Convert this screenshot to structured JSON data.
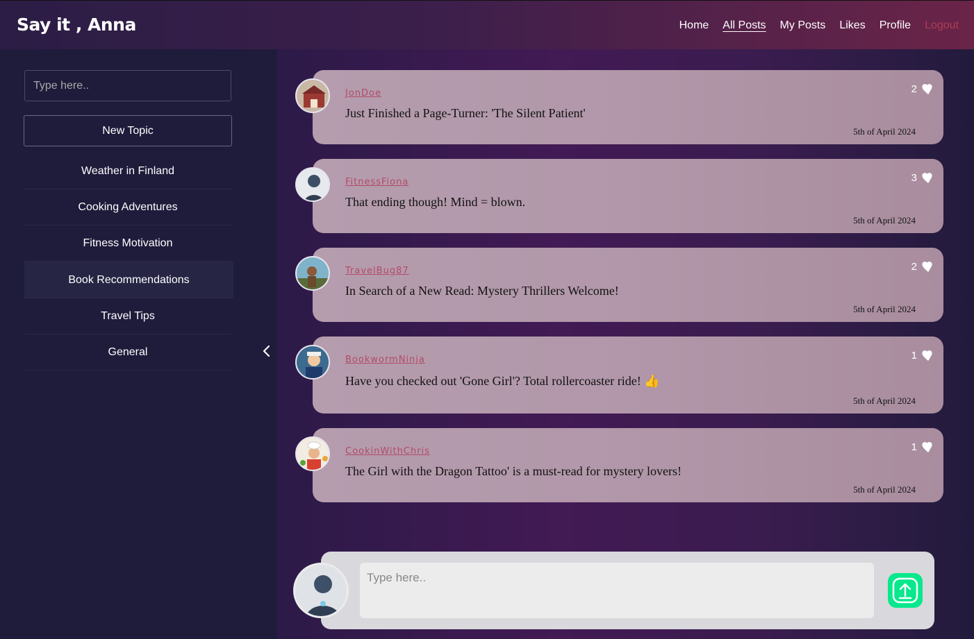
{
  "header": {
    "brand": "Say it , Anna",
    "nav": [
      {
        "label": "Home"
      },
      {
        "label": "All Posts",
        "active": true
      },
      {
        "label": "My Posts"
      },
      {
        "label": "Likes"
      },
      {
        "label": "Profile"
      },
      {
        "label": "Logout"
      }
    ]
  },
  "sidebar": {
    "search_placeholder": "Type here..",
    "new_topic_label": "New Topic",
    "topics": [
      {
        "label": "Weather in Finland"
      },
      {
        "label": "Cooking Adventures"
      },
      {
        "label": "Fitness Motivation"
      },
      {
        "label": "Book Recommendations",
        "active": true
      },
      {
        "label": "Travel Tips"
      },
      {
        "label": "General"
      }
    ],
    "collapse_icon": "chevron-left-icon"
  },
  "posts": [
    {
      "user": "JonDoe",
      "text": "Just Finished a Page-Turner: 'The Silent Patient'",
      "likes": "2",
      "date": "5th of April 2024"
    },
    {
      "user": "FitnessFiona",
      "text": "That ending though! Mind = blown.",
      "likes": "3",
      "date": "5th of April 2024"
    },
    {
      "user": "TravelBug87",
      "text": "In Search of a New Read: Mystery Thrillers Welcome!",
      "likes": "2",
      "date": "5th of April 2024"
    },
    {
      "user": "BookwormNinja",
      "text": "Have you checked out 'Gone Girl'? Total rollercoaster ride! 👍",
      "likes": "1",
      "date": "5th of April 2024"
    },
    {
      "user": "CookinWithChris",
      "text": "The Girl with the Dragon Tattoo' is a must-read for mystery lovers!",
      "likes": "1",
      "date": "5th of April 2024"
    }
  ],
  "composer": {
    "placeholder": "Type here..",
    "send_icon": "upload-icon"
  },
  "colors": {
    "accent": "#08e88c",
    "logout": "#b03a55",
    "username": "#b34a66"
  }
}
